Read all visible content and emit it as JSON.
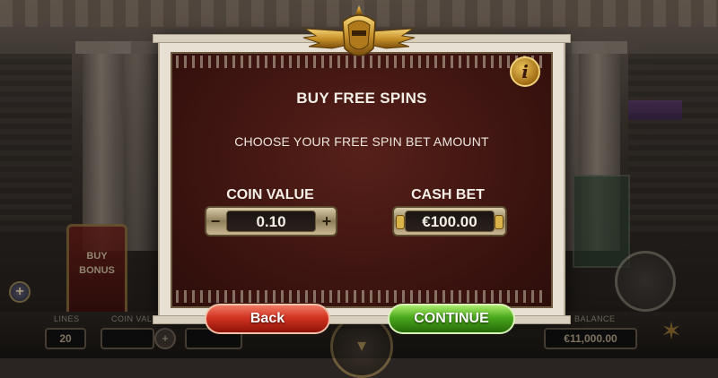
{
  "game": {
    "buy_bonus": {
      "line1": "BUY",
      "line2": "BONUS"
    },
    "bottom_bar": {
      "lines_label": "LINES",
      "lines_value": "20",
      "coin_value_label": "COIN VALUE",
      "balance_label": "BALANCE",
      "balance_value": "€11,000.00"
    }
  },
  "dialog": {
    "title": "BUY FREE SPINS",
    "subtitle": "CHOOSE YOUR FREE SPIN BET AMOUNT",
    "info_glyph": "i",
    "coin_value": {
      "label": "COIN VALUE",
      "value": "0.10",
      "minus": "−",
      "plus": "+"
    },
    "cash_bet": {
      "label": "CASH BET",
      "value": "€100.00"
    },
    "back_label": "Back",
    "continue_label": "CONTINUE"
  },
  "icons": [
    "winged-emblem-icon",
    "info-icon",
    "minus-icon",
    "plus-icon",
    "plus-circle-icon",
    "spin-arrow-icon"
  ],
  "colors": {
    "dialog_bg": "#3d1410",
    "frame": "#e8e1d3",
    "back_button": "#d23422",
    "continue_button": "#4aa81c",
    "gold": "#d9b24a"
  }
}
